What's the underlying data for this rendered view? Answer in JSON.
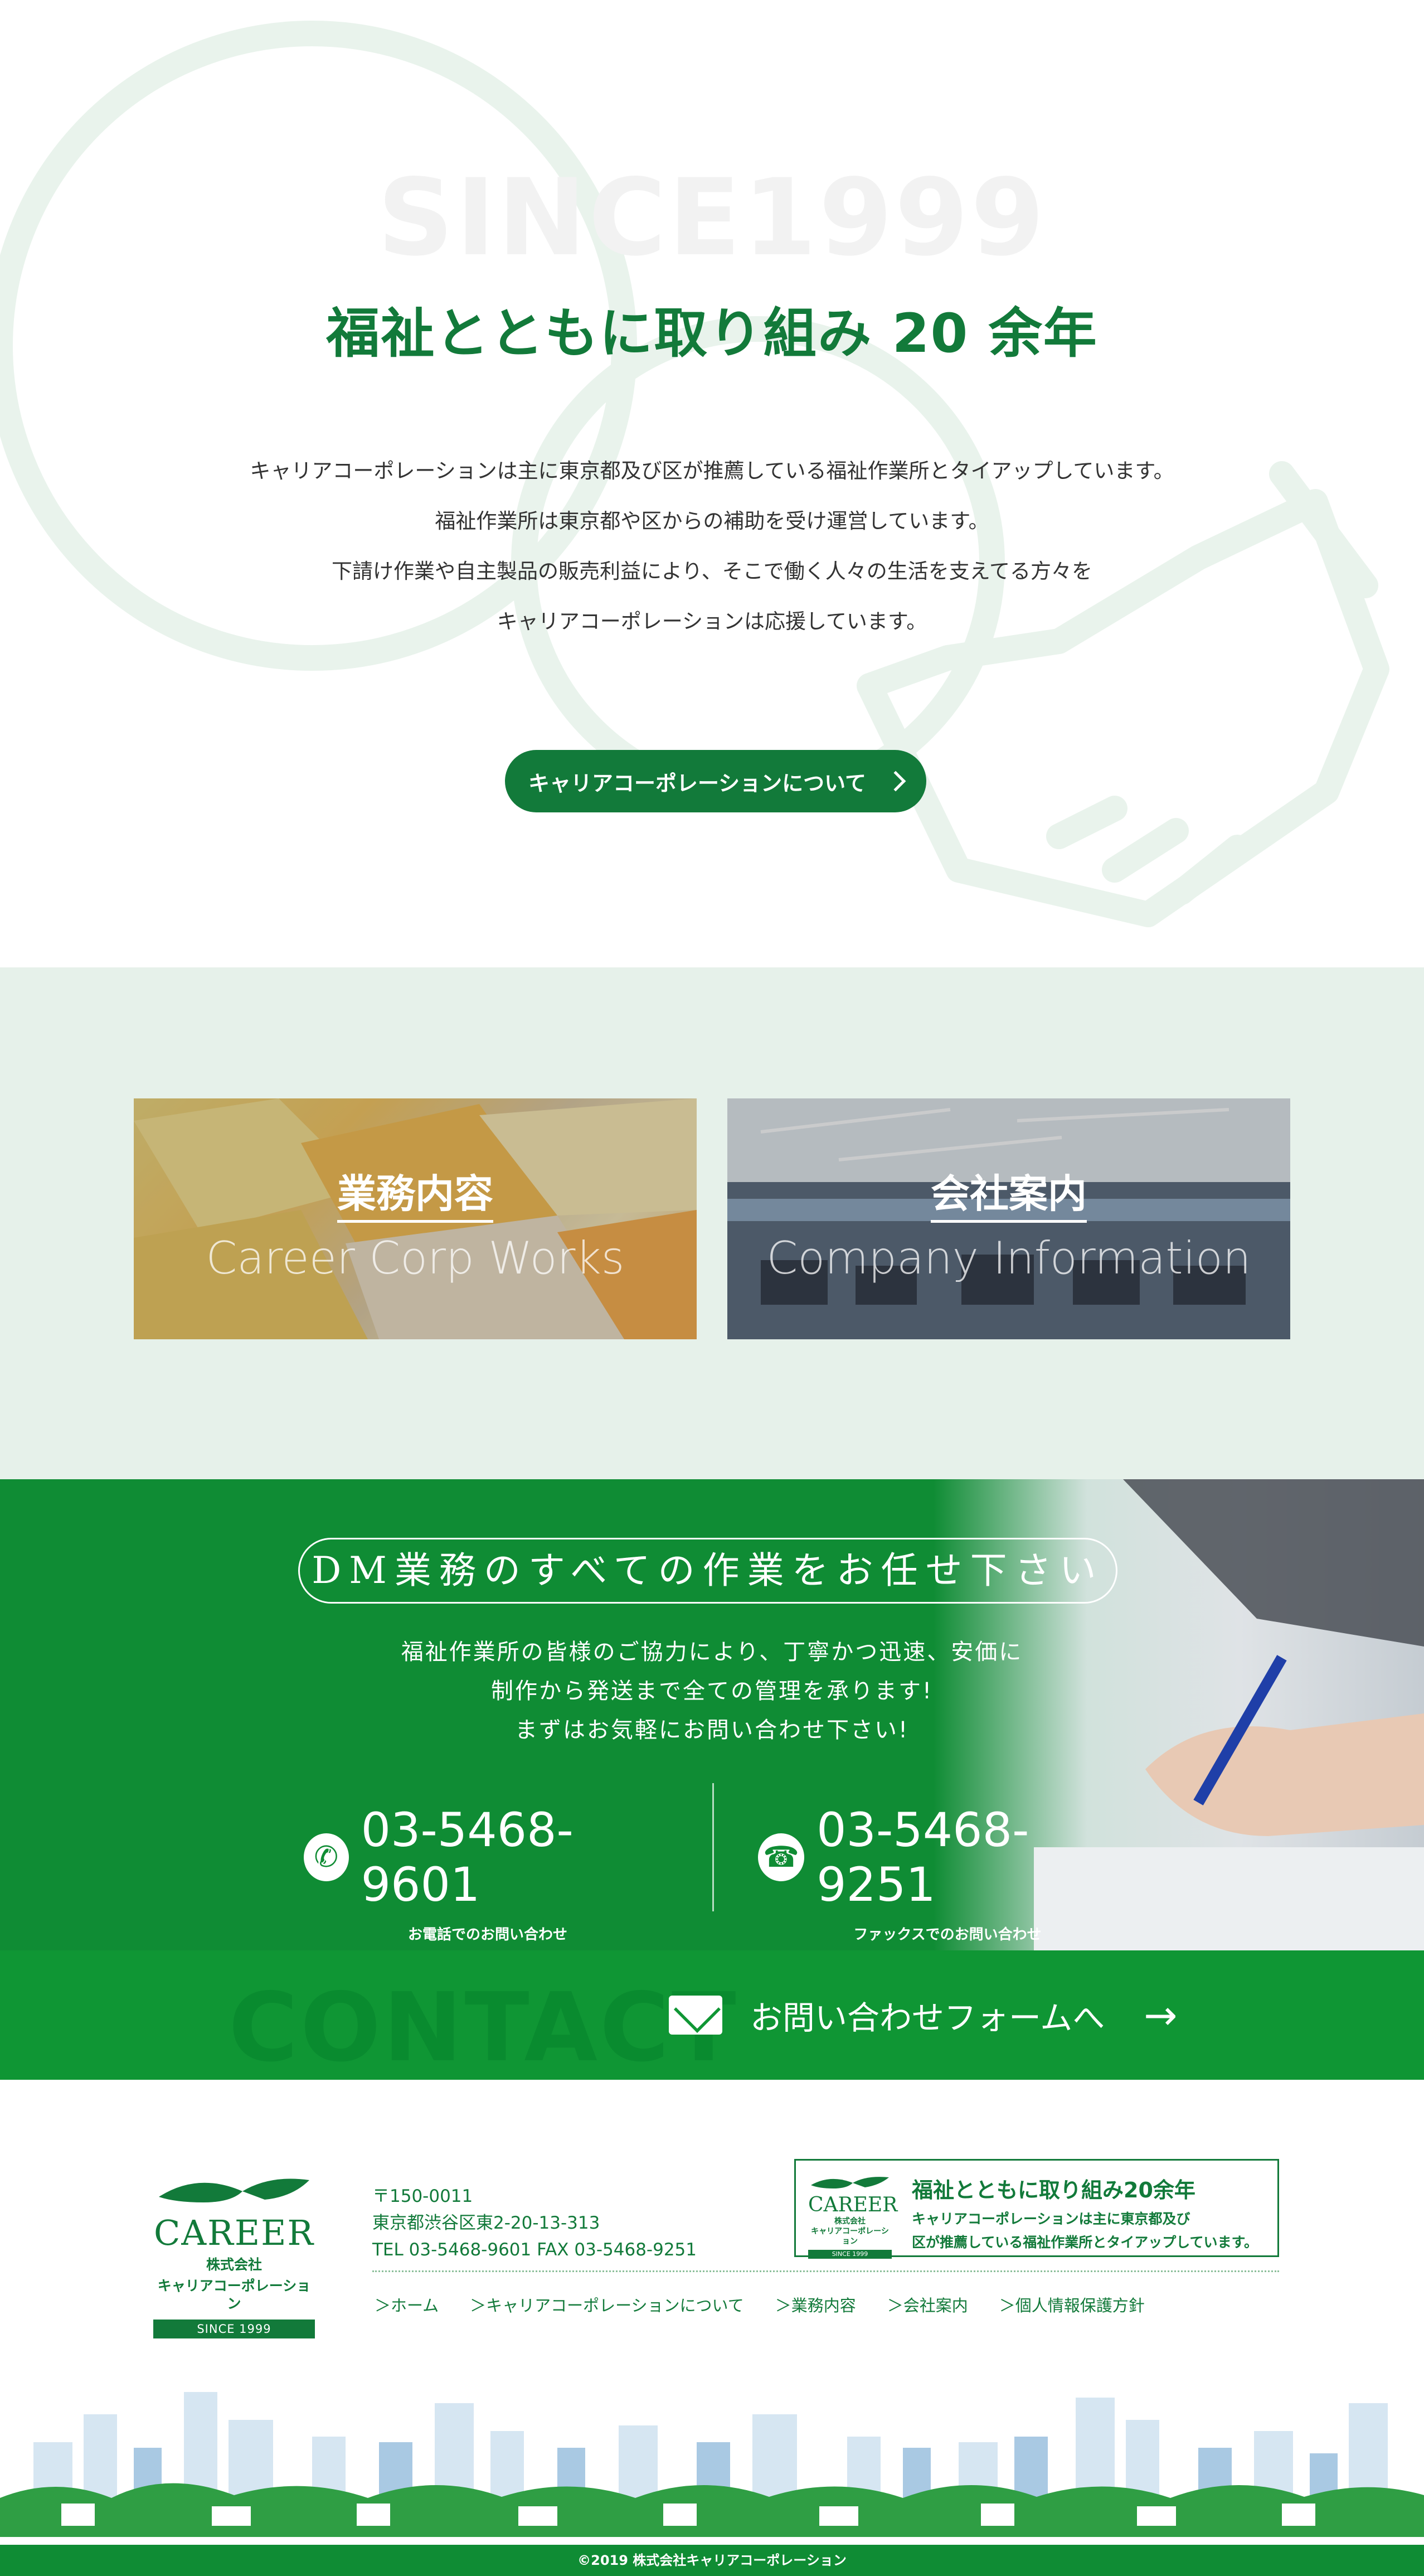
{
  "intro": {
    "watermark": "SINCE1999",
    "title": "福祉とともに取り組み 20 余年",
    "lines": [
      "キャリアコーポレーションは主に東京都及び区が推薦している福祉作業所とタイアップしています。",
      "福祉作業所は東京都や区からの補助を受け運営しています。",
      "下請け作業や自主製品の販売利益により、そこで働く人々の生活を支えてる方々を",
      "キャリアコーポレーションは応援しています。"
    ],
    "about_button": "キャリアコーポレーションについて"
  },
  "cards": {
    "works": {
      "jp": "業務内容",
      "en": "Career Corp Works"
    },
    "company": {
      "jp": "会社案内",
      "en": "Company Information"
    }
  },
  "dm": {
    "heading": "DM業務のすべての作業をお任せ下さい",
    "lines": [
      "福祉作業所の皆様のご協力により、丁寧かつ迅速、安価に",
      "制作から発送まで全ての管理を承ります!",
      "まずはお気軽にお問い合わせ下さい!"
    ],
    "tel": {
      "number": "03-5468-9601",
      "caption": "お電話でのお問い合わせ"
    },
    "fax": {
      "number": "03-5468-9251",
      "caption": "ファックスでのお問い合わせ"
    }
  },
  "contact": {
    "ghost_text": "CONTACT",
    "label": "お問い合わせフォームへ"
  },
  "footer": {
    "logo": {
      "word": "CAREER",
      "corp_line1": "株式会社",
      "corp_line2": "キャリアコーポレーション",
      "since": "SINCE 1999"
    },
    "address": {
      "zip": "〒150-0011",
      "street": "東京都渋谷区東2-20-13-313",
      "telfax": "TEL 03-5468-9601   FAX 03-5468-9251"
    },
    "badge": {
      "title": "福祉とともに取り組み20余年",
      "line1": "キャリアコーポレーションは主に東京都及び",
      "line2": "区が推薦している福祉作業所とタイアップしています。",
      "mini_word": "CAREER",
      "mini_corp1": "株式会社",
      "mini_corp2": "キャリアコーポレーション",
      "mini_since": "SINCE 1999"
    },
    "nav": [
      "＞ホーム",
      "＞キャリアコーポレーションについて",
      "＞業務内容",
      "＞会社案内",
      "＞個人情報保護方針"
    ],
    "copyright": "©2019 株式会社キャリアコーポレーション"
  },
  "colors": {
    "brand_green": "#127a3a",
    "bar_green": "#0f9634",
    "pale_green": "#e6f1ea"
  },
  "icons": [
    "magnifier-deco-icon",
    "handshake-deco-icon",
    "chevron-right-icon",
    "phone-icon",
    "fax-icon",
    "mail-icon",
    "arrow-right-icon",
    "leaf-logo-icon"
  ]
}
